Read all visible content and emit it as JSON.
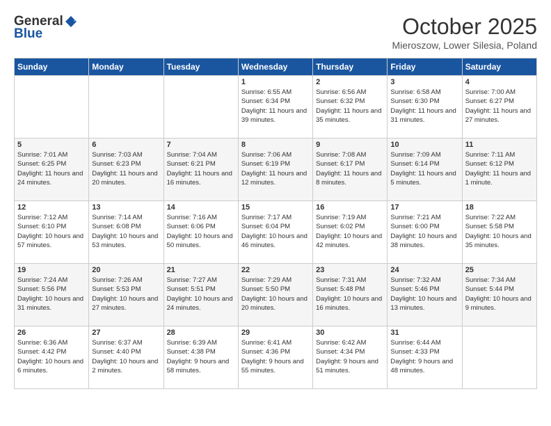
{
  "header": {
    "logo_general": "General",
    "logo_blue": "Blue",
    "month": "October 2025",
    "location": "Mieroszow, Lower Silesia, Poland"
  },
  "days_of_week": [
    "Sunday",
    "Monday",
    "Tuesday",
    "Wednesday",
    "Thursday",
    "Friday",
    "Saturday"
  ],
  "weeks": [
    [
      {
        "day": "",
        "info": ""
      },
      {
        "day": "",
        "info": ""
      },
      {
        "day": "",
        "info": ""
      },
      {
        "day": "1",
        "info": "Sunrise: 6:55 AM\nSunset: 6:34 PM\nDaylight: 11 hours and 39 minutes."
      },
      {
        "day": "2",
        "info": "Sunrise: 6:56 AM\nSunset: 6:32 PM\nDaylight: 11 hours and 35 minutes."
      },
      {
        "day": "3",
        "info": "Sunrise: 6:58 AM\nSunset: 6:30 PM\nDaylight: 11 hours and 31 minutes."
      },
      {
        "day": "4",
        "info": "Sunrise: 7:00 AM\nSunset: 6:27 PM\nDaylight: 11 hours and 27 minutes."
      }
    ],
    [
      {
        "day": "5",
        "info": "Sunrise: 7:01 AM\nSunset: 6:25 PM\nDaylight: 11 hours and 24 minutes."
      },
      {
        "day": "6",
        "info": "Sunrise: 7:03 AM\nSunset: 6:23 PM\nDaylight: 11 hours and 20 minutes."
      },
      {
        "day": "7",
        "info": "Sunrise: 7:04 AM\nSunset: 6:21 PM\nDaylight: 11 hours and 16 minutes."
      },
      {
        "day": "8",
        "info": "Sunrise: 7:06 AM\nSunset: 6:19 PM\nDaylight: 11 hours and 12 minutes."
      },
      {
        "day": "9",
        "info": "Sunrise: 7:08 AM\nSunset: 6:17 PM\nDaylight: 11 hours and 8 minutes."
      },
      {
        "day": "10",
        "info": "Sunrise: 7:09 AM\nSunset: 6:14 PM\nDaylight: 11 hours and 5 minutes."
      },
      {
        "day": "11",
        "info": "Sunrise: 7:11 AM\nSunset: 6:12 PM\nDaylight: 11 hours and 1 minute."
      }
    ],
    [
      {
        "day": "12",
        "info": "Sunrise: 7:12 AM\nSunset: 6:10 PM\nDaylight: 10 hours and 57 minutes."
      },
      {
        "day": "13",
        "info": "Sunrise: 7:14 AM\nSunset: 6:08 PM\nDaylight: 10 hours and 53 minutes."
      },
      {
        "day": "14",
        "info": "Sunrise: 7:16 AM\nSunset: 6:06 PM\nDaylight: 10 hours and 50 minutes."
      },
      {
        "day": "15",
        "info": "Sunrise: 7:17 AM\nSunset: 6:04 PM\nDaylight: 10 hours and 46 minutes."
      },
      {
        "day": "16",
        "info": "Sunrise: 7:19 AM\nSunset: 6:02 PM\nDaylight: 10 hours and 42 minutes."
      },
      {
        "day": "17",
        "info": "Sunrise: 7:21 AM\nSunset: 6:00 PM\nDaylight: 10 hours and 38 minutes."
      },
      {
        "day": "18",
        "info": "Sunrise: 7:22 AM\nSunset: 5:58 PM\nDaylight: 10 hours and 35 minutes."
      }
    ],
    [
      {
        "day": "19",
        "info": "Sunrise: 7:24 AM\nSunset: 5:56 PM\nDaylight: 10 hours and 31 minutes."
      },
      {
        "day": "20",
        "info": "Sunrise: 7:26 AM\nSunset: 5:53 PM\nDaylight: 10 hours and 27 minutes."
      },
      {
        "day": "21",
        "info": "Sunrise: 7:27 AM\nSunset: 5:51 PM\nDaylight: 10 hours and 24 minutes."
      },
      {
        "day": "22",
        "info": "Sunrise: 7:29 AM\nSunset: 5:50 PM\nDaylight: 10 hours and 20 minutes."
      },
      {
        "day": "23",
        "info": "Sunrise: 7:31 AM\nSunset: 5:48 PM\nDaylight: 10 hours and 16 minutes."
      },
      {
        "day": "24",
        "info": "Sunrise: 7:32 AM\nSunset: 5:46 PM\nDaylight: 10 hours and 13 minutes."
      },
      {
        "day": "25",
        "info": "Sunrise: 7:34 AM\nSunset: 5:44 PM\nDaylight: 10 hours and 9 minutes."
      }
    ],
    [
      {
        "day": "26",
        "info": "Sunrise: 6:36 AM\nSunset: 4:42 PM\nDaylight: 10 hours and 6 minutes."
      },
      {
        "day": "27",
        "info": "Sunrise: 6:37 AM\nSunset: 4:40 PM\nDaylight: 10 hours and 2 minutes."
      },
      {
        "day": "28",
        "info": "Sunrise: 6:39 AM\nSunset: 4:38 PM\nDaylight: 9 hours and 58 minutes."
      },
      {
        "day": "29",
        "info": "Sunrise: 6:41 AM\nSunset: 4:36 PM\nDaylight: 9 hours and 55 minutes."
      },
      {
        "day": "30",
        "info": "Sunrise: 6:42 AM\nSunset: 4:34 PM\nDaylight: 9 hours and 51 minutes."
      },
      {
        "day": "31",
        "info": "Sunrise: 6:44 AM\nSunset: 4:33 PM\nDaylight: 9 hours and 48 minutes."
      },
      {
        "day": "",
        "info": ""
      }
    ]
  ]
}
